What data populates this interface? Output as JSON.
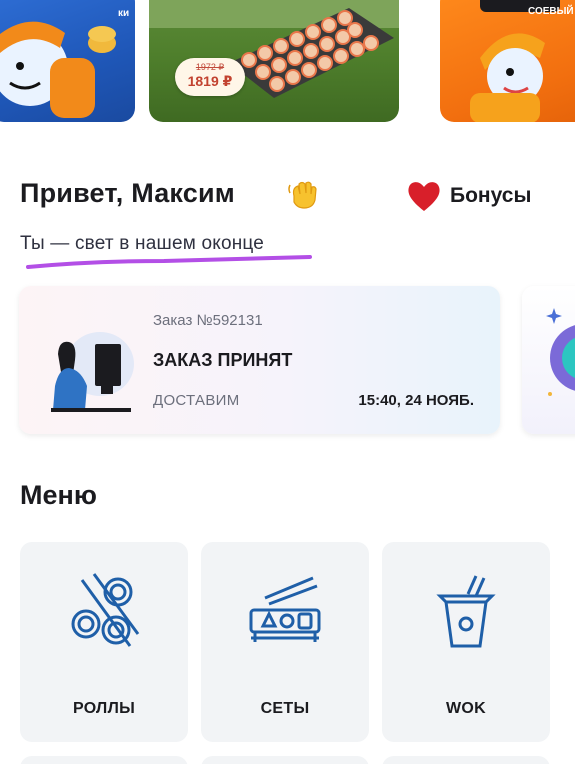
{
  "banners": [
    {
      "name": "promo-mascot-1",
      "text": "ки",
      "color": "#2f6fd6"
    },
    {
      "name": "promo-sushi-set",
      "old_price": "1972 ₽",
      "new_price": "1819 ₽",
      "color": "#4f7f2c"
    },
    {
      "name": "promo-mascot-2",
      "text": "СОЕВЫЙ",
      "color": "#f26f0f"
    }
  ],
  "greeting": {
    "title": "Привет, Максим",
    "subtitle": "Ты — свет в нашем оконце",
    "underline_color": "#b34fe6"
  },
  "bonus": {
    "label": "Бонусы",
    "icon": "heart-icon",
    "color": "#d81f2a"
  },
  "order": {
    "number": "Заказ №592131",
    "status": "ЗАКАЗ ПРИНЯТ",
    "delivery_label": "ДОСТАВИМ",
    "delivery_time": "15:40, 24 НОЯБ."
  },
  "menu": {
    "heading": "Меню",
    "tiles": [
      {
        "label": "РОЛЛЫ",
        "icon": "rolls-icon"
      },
      {
        "label": "СЕТЫ",
        "icon": "sushi-set-icon"
      },
      {
        "label": "WOK",
        "icon": "wok-box-icon"
      }
    ]
  },
  "colors": {
    "accent_icon": "#1f5fa8",
    "heart": "#d81f2a",
    "underline": "#b34fe6"
  }
}
